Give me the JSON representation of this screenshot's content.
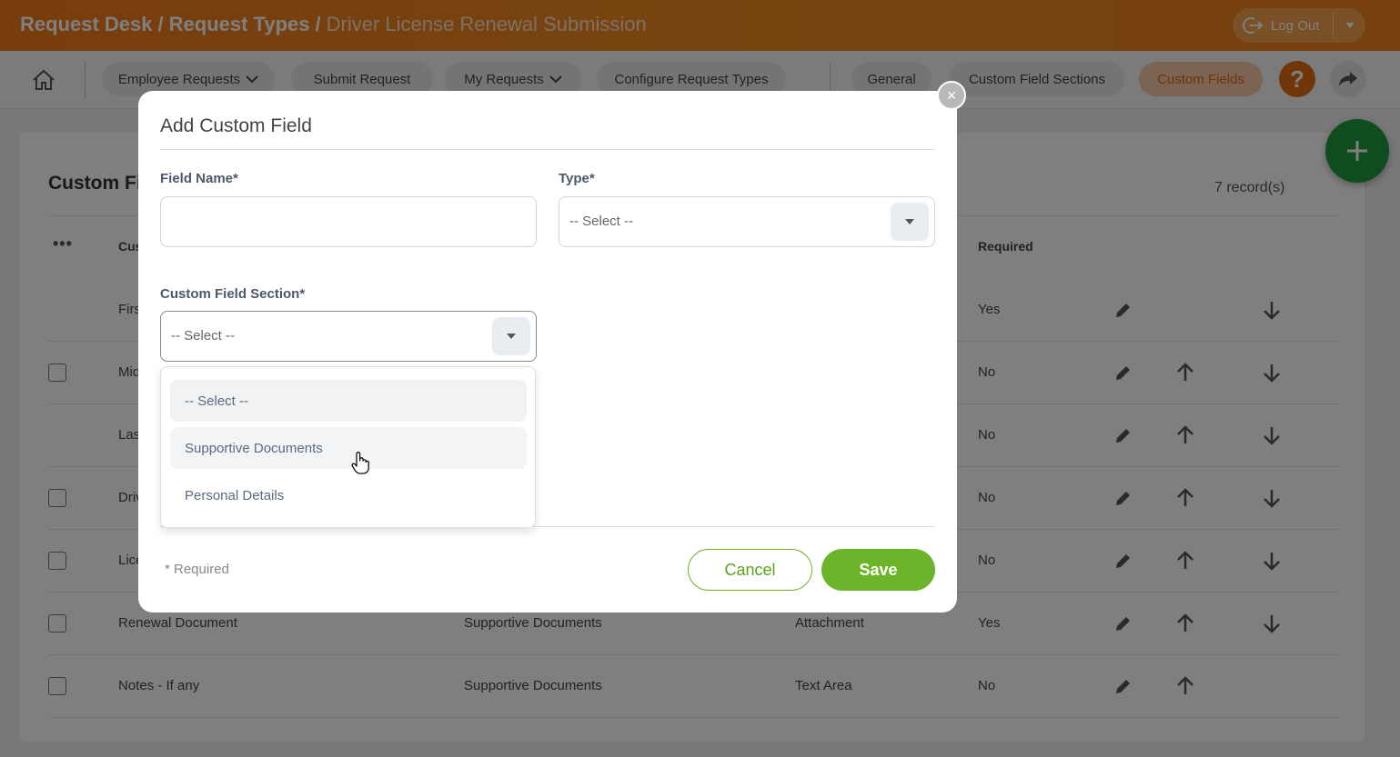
{
  "header": {
    "breadcrumb": [
      "Request Desk",
      "Request Types"
    ],
    "breadcrumb_sep": "/",
    "current_page": "Driver License Renewal Submission",
    "logout_label": "Log Out"
  },
  "nav": {
    "home_icon": "home-icon",
    "items": [
      {
        "label": "Employee Requests",
        "has_dropdown": true
      },
      {
        "label": "Submit Request",
        "has_dropdown": false
      },
      {
        "label": "My Requests",
        "has_dropdown": true
      },
      {
        "label": "Configure Request Types",
        "has_dropdown": false
      }
    ],
    "tabs": [
      {
        "label": "General",
        "active": false
      },
      {
        "label": "Custom Field Sections",
        "active": false
      },
      {
        "label": "Custom Fields",
        "active": true
      }
    ],
    "help_label": "?"
  },
  "table": {
    "title": "Custom Fi",
    "records": "7 record(s)",
    "more_label": "•••",
    "columns": {
      "name": "Cus",
      "required": "Required"
    },
    "rows": [
      {
        "name": "Firs",
        "section": "",
        "type": "",
        "required": "Yes",
        "checkbox": false,
        "up": false,
        "down": true
      },
      {
        "name": "Mid",
        "section": "",
        "type": "",
        "required": "No",
        "checkbox": true,
        "up": true,
        "down": true
      },
      {
        "name": "Las",
        "section": "",
        "type": "",
        "required": "No",
        "checkbox": false,
        "up": true,
        "down": true
      },
      {
        "name": "Driv",
        "section": "",
        "type": "",
        "required": "No",
        "checkbox": true,
        "up": true,
        "down": true
      },
      {
        "name": "Lice",
        "section": "",
        "type": "",
        "required": "No",
        "checkbox": true,
        "up": true,
        "down": true
      },
      {
        "name": "Renewal Document",
        "section": "Supportive Documents",
        "type": "Attachment",
        "required": "Yes",
        "checkbox": true,
        "up": true,
        "down": true
      },
      {
        "name": "Notes - If any",
        "section": "Supportive Documents",
        "type": "Text Area",
        "required": "No",
        "checkbox": true,
        "up": true,
        "down": false
      }
    ]
  },
  "modal": {
    "title": "Add Custom Field",
    "close_label": "×",
    "field_name_label": "Field Name*",
    "field_name_value": "",
    "type_label": "Type*",
    "type_value": "-- Select --",
    "section_label": "Custom Field Section*",
    "section_value": "-- Select --",
    "section_options": [
      "-- Select --",
      "Supportive Documents",
      "Personal Details"
    ],
    "required_note": "* Required",
    "cancel_label": "Cancel",
    "save_label": "Save"
  },
  "colors": {
    "header_orange": "#f07a1a",
    "accent_green": "#6cb52a",
    "fab_green": "#1e9a3c",
    "help_orange": "#e06c10"
  }
}
